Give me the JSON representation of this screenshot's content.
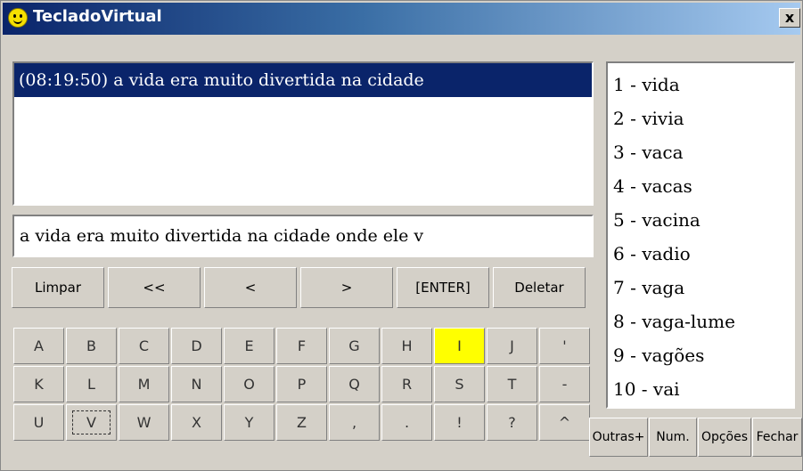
{
  "window": {
    "title": "TecladoVirtual",
    "close_label": "x"
  },
  "history": {
    "lines": [
      "(08:19:50) a vida era muito divertida na cidade"
    ]
  },
  "input": {
    "value": "a vida era muito divertida na cidade onde ele v"
  },
  "controls": [
    "Limpar",
    "<<",
    "<",
    ">",
    "[ENTER]",
    "Deletar"
  ],
  "keyboard": {
    "rows": [
      [
        "A",
        "B",
        "C",
        "D",
        "E",
        "F",
        "G",
        "H",
        "I",
        "J",
        "'"
      ],
      [
        "K",
        "L",
        "M",
        "N",
        "O",
        "P",
        "Q",
        "R",
        "S",
        "T",
        "-"
      ],
      [
        "U",
        "V",
        "W",
        "X",
        "Y",
        "Z",
        ",",
        ".",
        "!",
        "?",
        "^"
      ]
    ],
    "highlighted_key": "I",
    "focused_key": "V",
    "highlight_color": "#ffff00"
  },
  "suggestions": [
    "1 - vida",
    "2 - vivia",
    "3 - vaca",
    "4 - vacas",
    "5 - vacina",
    "6 - vadio",
    "7 - vaga",
    "8 - vaga-lume",
    "9 - vagões",
    "10 - vai"
  ],
  "option_buttons": [
    "Outras+",
    "Num.",
    "Opções",
    "Fechar"
  ]
}
